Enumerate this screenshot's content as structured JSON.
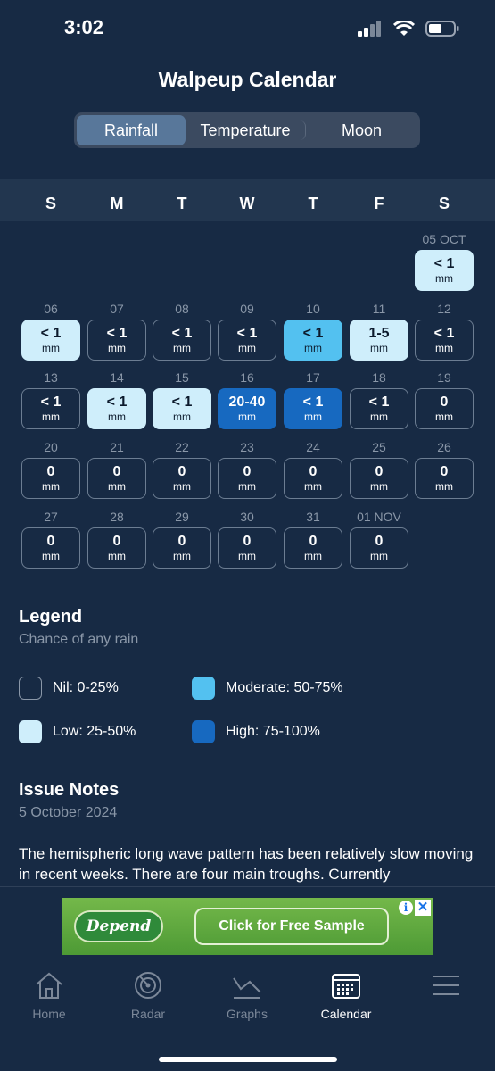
{
  "status": {
    "time": "3:02"
  },
  "header": {
    "title": "Walpeup Calendar"
  },
  "tabs": [
    {
      "label": "Rainfall"
    },
    {
      "label": "Temperature"
    },
    {
      "label": "Moon"
    }
  ],
  "weekdays": [
    "S",
    "M",
    "T",
    "W",
    "T",
    "F",
    "S"
  ],
  "calendar": [
    {
      "date": "05 OCT",
      "value": "< 1",
      "unit": "mm",
      "level": "low"
    },
    {
      "date": "06",
      "value": "< 1",
      "unit": "mm",
      "level": "low"
    },
    {
      "date": "07",
      "value": "< 1",
      "unit": "mm",
      "level": "nil"
    },
    {
      "date": "08",
      "value": "< 1",
      "unit": "mm",
      "level": "nil"
    },
    {
      "date": "09",
      "value": "< 1",
      "unit": "mm",
      "level": "nil"
    },
    {
      "date": "10",
      "value": "< 1",
      "unit": "mm",
      "level": "moderate"
    },
    {
      "date": "11",
      "value": "1-5",
      "unit": "mm",
      "level": "low"
    },
    {
      "date": "12",
      "value": "< 1",
      "unit": "mm",
      "level": "nil"
    },
    {
      "date": "13",
      "value": "< 1",
      "unit": "mm",
      "level": "nil"
    },
    {
      "date": "14",
      "value": "< 1",
      "unit": "mm",
      "level": "low"
    },
    {
      "date": "15",
      "value": "< 1",
      "unit": "mm",
      "level": "low"
    },
    {
      "date": "16",
      "value": "20-40",
      "unit": "mm",
      "level": "high"
    },
    {
      "date": "17",
      "value": "< 1",
      "unit": "mm",
      "level": "high"
    },
    {
      "date": "18",
      "value": "< 1",
      "unit": "mm",
      "level": "nil"
    },
    {
      "date": "19",
      "value": "0",
      "unit": "mm",
      "level": "nil"
    },
    {
      "date": "20",
      "value": "0",
      "unit": "mm",
      "level": "nil"
    },
    {
      "date": "21",
      "value": "0",
      "unit": "mm",
      "level": "nil"
    },
    {
      "date": "22",
      "value": "0",
      "unit": "mm",
      "level": "nil"
    },
    {
      "date": "23",
      "value": "0",
      "unit": "mm",
      "level": "nil"
    },
    {
      "date": "24",
      "value": "0",
      "unit": "mm",
      "level": "nil"
    },
    {
      "date": "25",
      "value": "0",
      "unit": "mm",
      "level": "nil"
    },
    {
      "date": "26",
      "value": "0",
      "unit": "mm",
      "level": "nil"
    },
    {
      "date": "27",
      "value": "0",
      "unit": "mm",
      "level": "nil"
    },
    {
      "date": "28",
      "value": "0",
      "unit": "mm",
      "level": "nil"
    },
    {
      "date": "29",
      "value": "0",
      "unit": "mm",
      "level": "nil"
    },
    {
      "date": "30",
      "value": "0",
      "unit": "mm",
      "level": "nil"
    },
    {
      "date": "31",
      "value": "0",
      "unit": "mm",
      "level": "nil"
    },
    {
      "date": "01 NOV",
      "value": "0",
      "unit": "mm",
      "level": "nil"
    }
  ],
  "legend": {
    "title": "Legend",
    "subtitle": "Chance of any rain",
    "items": [
      {
        "label": "Nil: 0-25%",
        "level": "nil"
      },
      {
        "label": "Moderate: 50-75%",
        "level": "moderate"
      },
      {
        "label": "Low: 25-50%",
        "level": "low"
      },
      {
        "label": "High: 75-100%",
        "level": "high"
      }
    ]
  },
  "notes": {
    "title": "Issue Notes",
    "date": "5 October 2024",
    "body": "The hemispheric long wave pattern has been relatively slow moving in recent weeks. There are four main troughs. Currently"
  },
  "ad": {
    "brand": "Depend",
    "cta": "Click for Free Sample"
  },
  "nav": [
    {
      "label": "Home",
      "icon": "home-icon"
    },
    {
      "label": "Radar",
      "icon": "radar-icon"
    },
    {
      "label": "Graphs",
      "icon": "graph-icon"
    },
    {
      "label": "Calendar",
      "icon": "calendar-icon"
    },
    {
      "label": "",
      "icon": "menu-icon"
    }
  ],
  "colors": {
    "background": "#172a44",
    "low": "#cfeefb",
    "moderate": "#53c1f0",
    "high": "#1769c0"
  }
}
